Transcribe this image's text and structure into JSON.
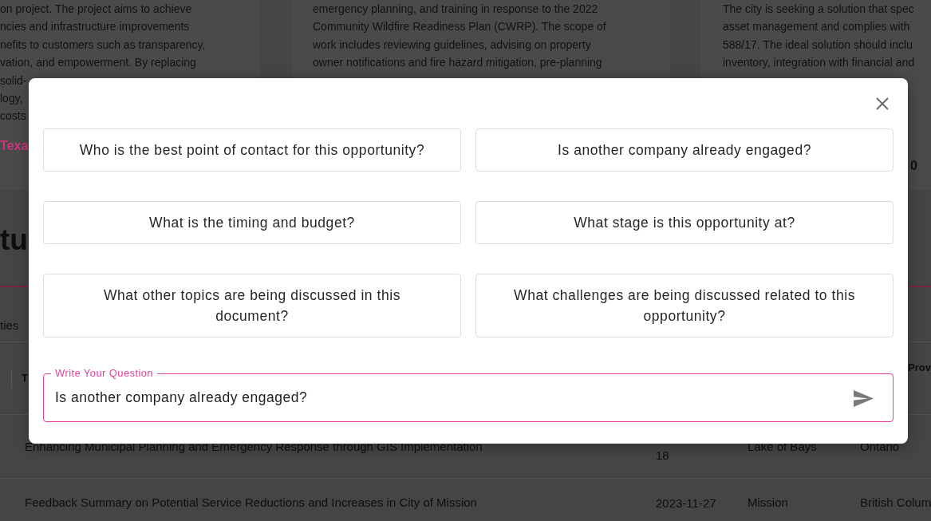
{
  "page": {
    "cards": [
      {
        "lines": [
          "on project. The project aims to achieve",
          "ncies and infrastructure improvements",
          "nefits to customers such as transparency,",
          "vation, and empowerment. By replacing",
          "solid-",
          "logy,",
          "costs"
        ],
        "link": "Texa"
      },
      {
        "lines": [
          "emergency planning, and training in response to the 2022",
          "Community Wildfire Readiness Plan (CWRP). The scope of",
          "work includes reviewing guidelines, advising on property",
          "owner notifications and fire hazard mitigation, pre-planning"
        ]
      },
      {
        "lines": [
          "The city is seeking a solution that spec",
          "asset management and complies with",
          "588/17. The ideal solution should inclu",
          "inventory, integration with financial and"
        ],
        "amount": "0"
      }
    ],
    "heading": "tu",
    "tab": "ties",
    "table": {
      "columns": [
        "T",
        "Prov"
      ],
      "rows": [
        {
          "cells": [
            "Enhancing Municipal Planning and Emergency Response through GIS Implementation",
            "18",
            "Lake of Bays",
            "Ontario"
          ]
        },
        {
          "cells": [
            "Feedback Summary on Potential Service Reductions and Increases in City of Mission",
            "2023-11-27",
            "Mission",
            "British Colum"
          ]
        }
      ]
    }
  },
  "dialog": {
    "suggestions": [
      "Who is the best point of contact for this opportunity?",
      "Is another company already engaged?",
      "What is the timing and budget?",
      "What stage is this opportunity at?",
      "What other topics are being discussed in this document?",
      "What challenges are being discussed related to this opportunity?"
    ],
    "question": {
      "label": "Write Your Question",
      "value": "Is another company already engaged?"
    }
  }
}
